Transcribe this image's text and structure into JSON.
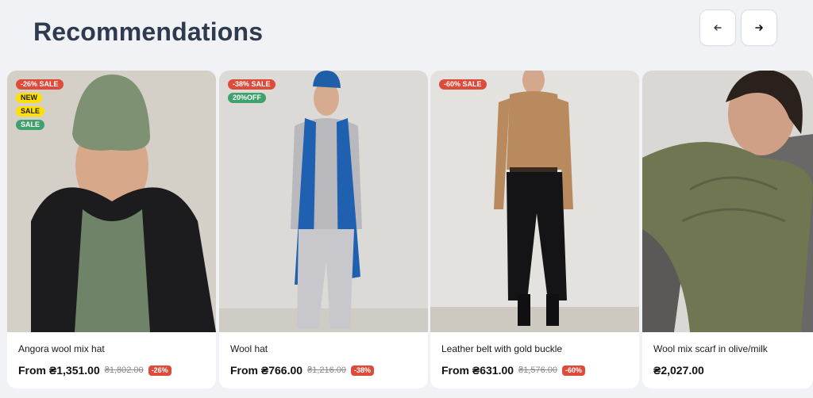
{
  "header": {
    "title": "Recommendations",
    "prev_icon": "arrow-left-icon",
    "next_icon": "arrow-right-icon"
  },
  "products": [
    {
      "name": "Angora wool mix hat",
      "price": "From ₴1,351.00",
      "old_price": "₴1,802.00",
      "discount": "-26%",
      "badges": [
        "-26% SALE",
        "NEW",
        "SALE",
        "SALE"
      ]
    },
    {
      "name": "Wool hat",
      "price": "From ₴766.00",
      "old_price": "₴1,216.00",
      "discount": "-38%",
      "badges": [
        "-38% SALE",
        "20%OFF"
      ]
    },
    {
      "name": "Leather belt with gold buckle",
      "price": "From ₴631.00",
      "old_price": "₴1,576.00",
      "discount": "-60%",
      "badges": [
        "-60% SALE"
      ]
    },
    {
      "name": "Wool mix scarf in olive/milk",
      "price": "₴2,027.00"
    }
  ],
  "colors": {
    "sale_badge": "#de4b3a",
    "new_badge": "#ffe000",
    "green_badge": "#3fa16b",
    "title": "#2f3a4f"
  }
}
